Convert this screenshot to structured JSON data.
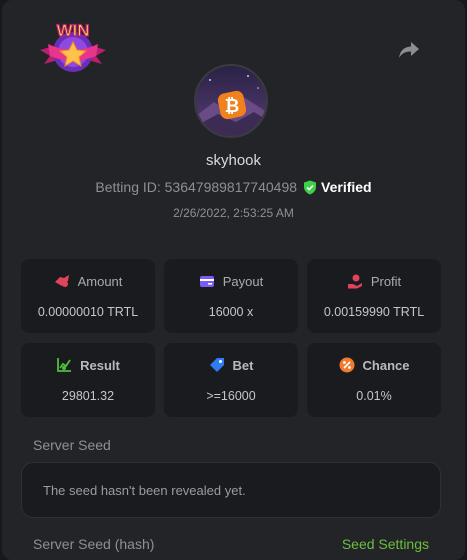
{
  "header": {
    "badge_text": "WIN",
    "share_icon": "share-icon",
    "avatar_icon": "bitcoin-icon"
  },
  "user": {
    "name": "skyhook",
    "betting_id_label": "Betting ID: 53647989817740498",
    "verified_label": "Verified",
    "timestamp": "2/26/2022, 2:53:25 AM"
  },
  "stats": [
    {
      "label": "Amount",
      "value": "0.00000010 TRTL",
      "icon": "coins-icon",
      "color": "#e0435a"
    },
    {
      "label": "Payout",
      "value": "16000 x",
      "icon": "wallet-icon",
      "color": "#7a5af8"
    },
    {
      "label": "Profit",
      "value": "0.00159990 TRTL",
      "icon": "hand-coin-icon",
      "color": "#e0435a"
    },
    {
      "label": "Result",
      "value": "29801.32",
      "icon": "chart-icon",
      "color": "#4fbf3a"
    },
    {
      "label": "Bet",
      "value": ">=16000",
      "icon": "tag-icon",
      "color": "#2f7bf0"
    },
    {
      "label": "Chance",
      "value": "0.01%",
      "icon": "percent-icon",
      "color": "#f07a2f"
    }
  ],
  "server_seed": {
    "label": "Server Seed",
    "message": "The seed hasn't been revealed yet.",
    "hash_label": "Server Seed (hash)",
    "settings_link": "Seed Settings"
  },
  "colors": {
    "verified_shield": "#3fcf4a",
    "link_green": "#6abf3d",
    "panel": "#232427",
    "card": "#1a1b1e"
  }
}
